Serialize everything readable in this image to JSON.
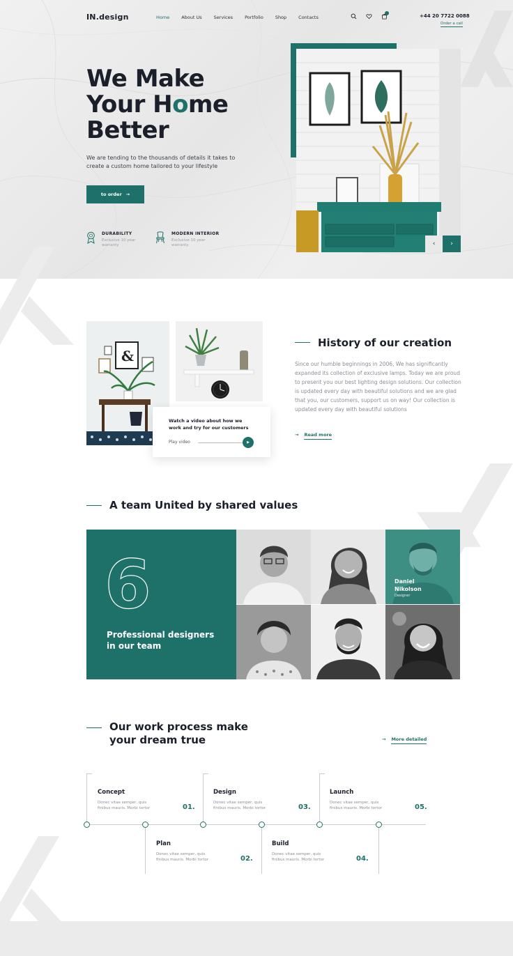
{
  "brand": {
    "logo": "IN.design",
    "accent": "#1e7168"
  },
  "nav": {
    "items": [
      {
        "label": "Home",
        "active": true
      },
      {
        "label": "About Us",
        "active": false
      },
      {
        "label": "Services",
        "active": false
      },
      {
        "label": "Portfolio",
        "active": false
      },
      {
        "label": "Shop",
        "active": false
      },
      {
        "label": "Contacts",
        "active": false
      }
    ],
    "icons": [
      "search-icon",
      "heart-icon",
      "cart-icon"
    ],
    "phone": "+44 20 7722 0088",
    "order_call": "Order a call"
  },
  "hero": {
    "title_line1": "We Make",
    "title_line2_a": "Your H",
    "title_line2_o": "o",
    "title_line2_b": "me",
    "title_line3": "Better",
    "subtitle": "We are tending to the thousands of details it takes to create a custom home tailored to your lifestyle",
    "cta": "to order",
    "features": [
      {
        "title": "DURABILITY",
        "desc": "Exclusive 10 year warranty",
        "icon": "medal-icon"
      },
      {
        "title": "MODERN INTERIOR",
        "desc": "Exclusive 10 year warranty",
        "icon": "chair-icon"
      }
    ],
    "slider_prev": "‹",
    "slider_next": "›"
  },
  "history": {
    "title": "History of our creation",
    "text": "Since our humble beginnings in 2006, We has significantly expanded its collection of exclusive lamps. Today we are proud to present you our best lighting design solutions. Our collection is updated every day with beautiful solutions and we are glad that you, our customers, support us on way! Our collection is updated every day with beautiful solutions",
    "read_more": "Read more",
    "video_text": "Watch a video about how we work and try for our customers",
    "play_video": "Play video"
  },
  "team": {
    "title": "A team United by shared values",
    "number": "6",
    "panel_text": "Professional designers in our team",
    "featured_name": "Daniel Nikolson",
    "featured_role": "Designer"
  },
  "process": {
    "title_line1": "Our work process make",
    "title_line2": "your dream true",
    "more": "More detailed",
    "steps": [
      {
        "title": "Concept",
        "desc": "Donec vitae semper, quis finibus mauris. Morbi tortor",
        "num": "01."
      },
      {
        "title": "Plan",
        "desc": "Donec vitae semper, quis finibus mauris. Morbi tortor",
        "num": "02."
      },
      {
        "title": "Design",
        "desc": "Donec vitae semper, quis finibus mauris. Morbi tortor",
        "num": "03."
      },
      {
        "title": "Build",
        "desc": "Donec vitae semper, quis finibus mauris. Morbi tortor",
        "num": "04."
      },
      {
        "title": "Launch",
        "desc": "Donec vitae semper, quis finibus mauris. Morbi tortor",
        "num": "05."
      }
    ]
  }
}
